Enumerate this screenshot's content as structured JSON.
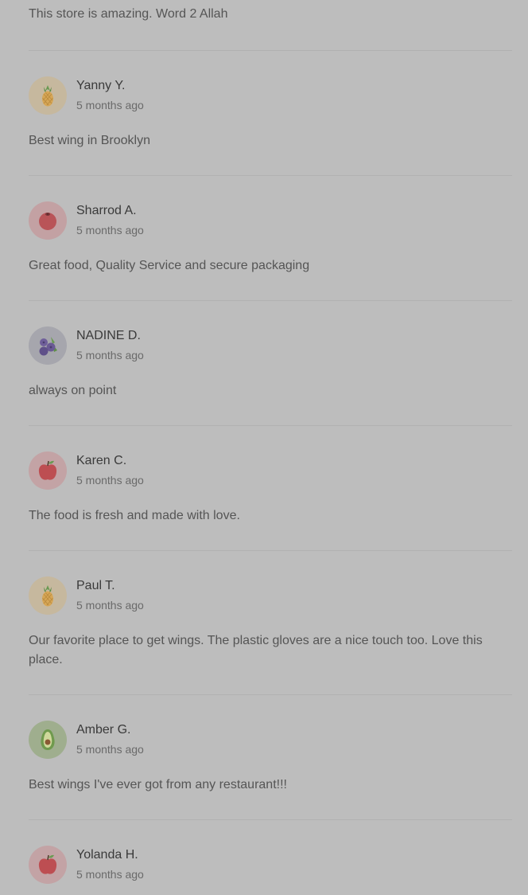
{
  "top_review_text": "This store is amazing. Word 2 Allah",
  "reviews": [
    {
      "name": "Yanny Y.",
      "time": "5 months ago",
      "text": "Best wing in Brooklyn",
      "avatar": "pineapple-icon",
      "avatar_bg": "#c6b89e"
    },
    {
      "name": "Sharrod A.",
      "time": "5 months ago",
      "text": "Great food, Quality Service and secure packaging",
      "avatar": "tomato-icon",
      "avatar_bg": "#c3a1a3"
    },
    {
      "name": "NADINE D.",
      "time": "5 months ago",
      "text": "always on point",
      "avatar": "blueberries-icon",
      "avatar_bg": "#a6a6ad"
    },
    {
      "name": "Karen C.",
      "time": "5 months ago",
      "text": "The food is fresh and made with love.",
      "avatar": "apple-icon",
      "avatar_bg": "#c3a3a5"
    },
    {
      "name": "Paul T.",
      "time": "5 months ago",
      "text": "Our favorite place to get wings. The plastic gloves are a nice touch too. Love this place.",
      "avatar": "pineapple-icon",
      "avatar_bg": "#c6b89e"
    },
    {
      "name": "Amber G.",
      "time": "5 months ago",
      "text": "Best wings I've ever got from any restaurant!!!",
      "avatar": "avocado-icon",
      "avatar_bg": "#9fae8e"
    },
    {
      "name": "Yolanda H.",
      "time": "5 months ago",
      "text": "",
      "avatar": "apple-icon",
      "avatar_bg": "#c3a3a5"
    }
  ]
}
